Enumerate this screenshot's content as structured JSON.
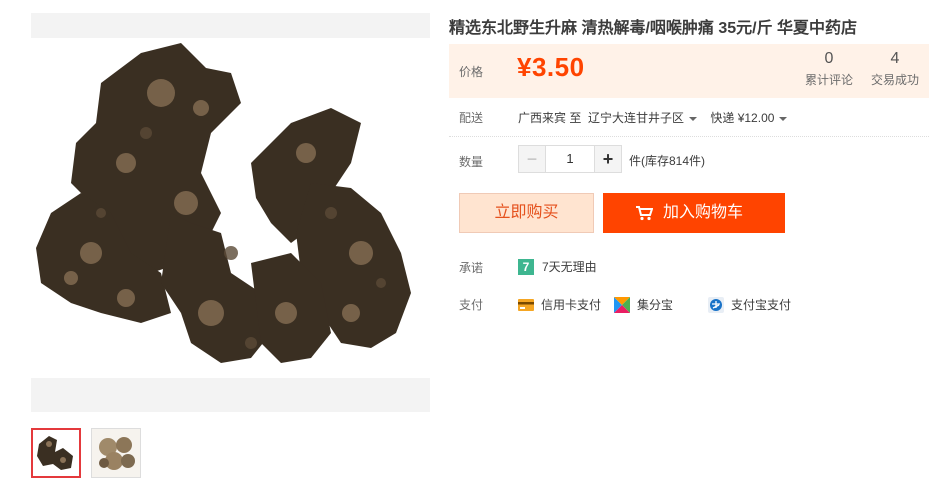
{
  "product": {
    "title": "精选东北野生升麻 清热解毒/咽喉肿痛 35元/斤 华夏中药店"
  },
  "price": {
    "label": "价格",
    "value": "¥3.50",
    "reviews_count": "0",
    "reviews_label": "累计评论",
    "sales_count": "4",
    "sales_label": "交易成功"
  },
  "delivery": {
    "label": "配送",
    "from_to": "广西来宾 至",
    "destination": "辽宁大连甘井子区",
    "shipping": "快递 ¥12.00"
  },
  "quantity": {
    "label": "数量",
    "value": "1",
    "minus": "−",
    "plus": "+",
    "stock": "件(库存814件)"
  },
  "actions": {
    "buy_now": "立即购买",
    "add_to_cart": "加入购物车"
  },
  "promise": {
    "label": "承诺",
    "icon_text": "7",
    "text": "7天无理由"
  },
  "payment": {
    "label": "支付",
    "methods": [
      "信用卡支付",
      "集分宝",
      "支付宝支付"
    ]
  },
  "colors": {
    "accent": "#ff4400",
    "price_bg": "#fff2e8",
    "buy_bg": "#ffe4d0",
    "promise_green": "#3eb690"
  },
  "icons": [
    "cart-icon",
    "credit-card-icon",
    "jifenbao-icon",
    "alipay-icon",
    "seven-day-icon",
    "caret-down-icon"
  ]
}
